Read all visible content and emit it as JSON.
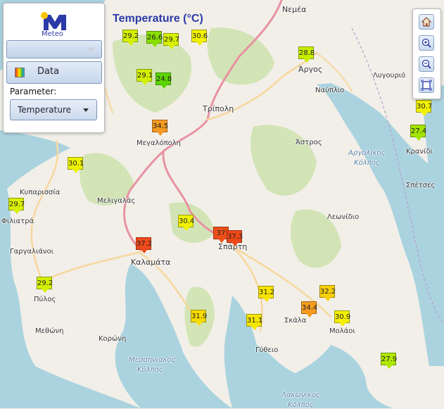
{
  "map": {
    "title": "Temperature (°C)",
    "colors": {
      "land": "#f2efe9",
      "sea": "#aad3df",
      "forest": "#cfe3b0",
      "primary_road": "#e892a2",
      "secondary_road": "#f7d79e"
    }
  },
  "panel": {
    "logo_text": "Meteo",
    "data_button": "Data",
    "parameter_label": "Parameter:",
    "parameter_value": "Temperature",
    "back_icon": "arrow-left-icon",
    "data_icon": "rainbow-palette-icon"
  },
  "toolbar": {
    "icons": [
      "home-icon",
      "zoom-in-icon",
      "zoom-out-icon",
      "fit-extent-icon"
    ]
  },
  "places": [
    {
      "name": "Νεμέα"
    },
    {
      "name": "Άργος"
    },
    {
      "name": "Ναύπλιο"
    },
    {
      "name": "Λυγουριό"
    },
    {
      "name": "Τρίπολη"
    },
    {
      "name": "Μεγαλόπολη"
    },
    {
      "name": "Άστρος"
    },
    {
      "name": "Κρανίδι"
    },
    {
      "name": "Σπέτσες"
    },
    {
      "name": "Κυπαρισσία"
    },
    {
      "name": "Φιλιατρά"
    },
    {
      "name": "Μελιγαλάς"
    },
    {
      "name": "Γαργαλιάνοι"
    },
    {
      "name": "Λεωνίδιο"
    },
    {
      "name": "Καλαμάτα"
    },
    {
      "name": "Σπάρτη"
    },
    {
      "name": "Πύλος"
    },
    {
      "name": "Μεθώνη"
    },
    {
      "name": "Κορώνη"
    },
    {
      "name": "Σκάλα"
    },
    {
      "name": "Μολάοι"
    },
    {
      "name": "Γύθειο"
    },
    {
      "name": "Αργολικός"
    },
    {
      "name": "Κόλπος"
    },
    {
      "name": "Μεσσηνιακός"
    },
    {
      "name": "Κόλπος"
    },
    {
      "name": "Λακωνικός"
    },
    {
      "name": "Κόλπος"
    }
  ],
  "stations": [
    {
      "value": "29.2",
      "color": "#d4f000"
    },
    {
      "value": "26.6",
      "color": "#88e000"
    },
    {
      "value": "29.7",
      "color": "#d8f000"
    },
    {
      "value": "30.6",
      "color": "#f2f200"
    },
    {
      "value": "28.8",
      "color": "#c8ee00"
    },
    {
      "value": "29.1",
      "color": "#d2f000"
    },
    {
      "value": "24.8",
      "color": "#5cd400"
    },
    {
      "value": "34.5",
      "color": "#f59a20"
    },
    {
      "value": "30.7",
      "color": "#f2f200"
    },
    {
      "value": "27.4",
      "color": "#a4e400"
    },
    {
      "value": "30.1",
      "color": "#ecf200"
    },
    {
      "value": "29.7",
      "color": "#d8f000"
    },
    {
      "value": "30.4",
      "color": "#f0f200"
    },
    {
      "value": "37.2",
      "color": "#ef4a1a"
    },
    {
      "value": "37",
      "color": "#ef501a"
    },
    {
      "value": "37.3",
      "color": "#ee4818"
    },
    {
      "value": "29.2",
      "color": "#d4f000"
    },
    {
      "value": "31.2",
      "color": "#f7e400"
    },
    {
      "value": "32.2",
      "color": "#f8cf0a"
    },
    {
      "value": "34.4",
      "color": "#f59c20"
    },
    {
      "value": "30.9",
      "color": "#f4f000"
    },
    {
      "value": "31.9",
      "color": "#f8dc00"
    },
    {
      "value": "31.1",
      "color": "#f6e600"
    },
    {
      "value": "27.9",
      "color": "#b0e800"
    }
  ]
}
